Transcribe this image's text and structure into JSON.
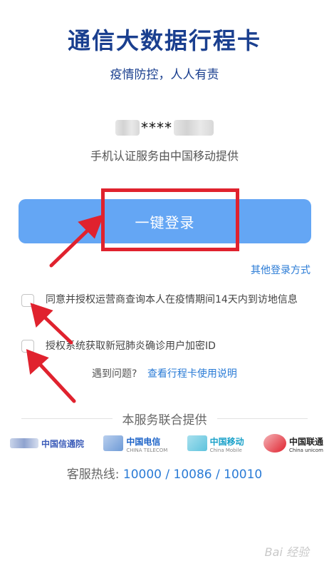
{
  "header": {
    "title": "通信大数据行程卡",
    "subtitle": "疫情防控，人人有责"
  },
  "phone": {
    "masked": "****",
    "provider_note": "手机认证服务由中国移动提供"
  },
  "login": {
    "button_label": "一键登录",
    "other_methods": "其他登录方式"
  },
  "consents": [
    {
      "text": "同意并授权运营商查询本人在疫情期间14天内到访地信息",
      "checked": false
    },
    {
      "text": "授权系统获取新冠肺炎确诊用户加密ID",
      "checked": false
    }
  ],
  "help": {
    "question": "遇到问题?",
    "link": "查看行程卡使用说明"
  },
  "providers": {
    "heading": "本服务联合提供",
    "logos": [
      {
        "name": "中国信通院",
        "sub": "",
        "color": "#3a5bb8"
      },
      {
        "name": "中国电信",
        "sub": "CHINA TELECOM",
        "color": "#1e64c8"
      },
      {
        "name": "中国移动",
        "sub": "China Mobile",
        "color": "#1aa1c9"
      },
      {
        "name": "中国联通",
        "sub": "China unicom",
        "color": "#e0222e"
      }
    ]
  },
  "hotline": {
    "label": "客服热线:",
    "numbers": "10000 / 10086 / 10010"
  },
  "watermark": "Bai 经验",
  "colors": {
    "title": "#1a3f8f",
    "button": "#64a6f4",
    "link": "#2a7bd6",
    "annotation": "#e0222e"
  }
}
